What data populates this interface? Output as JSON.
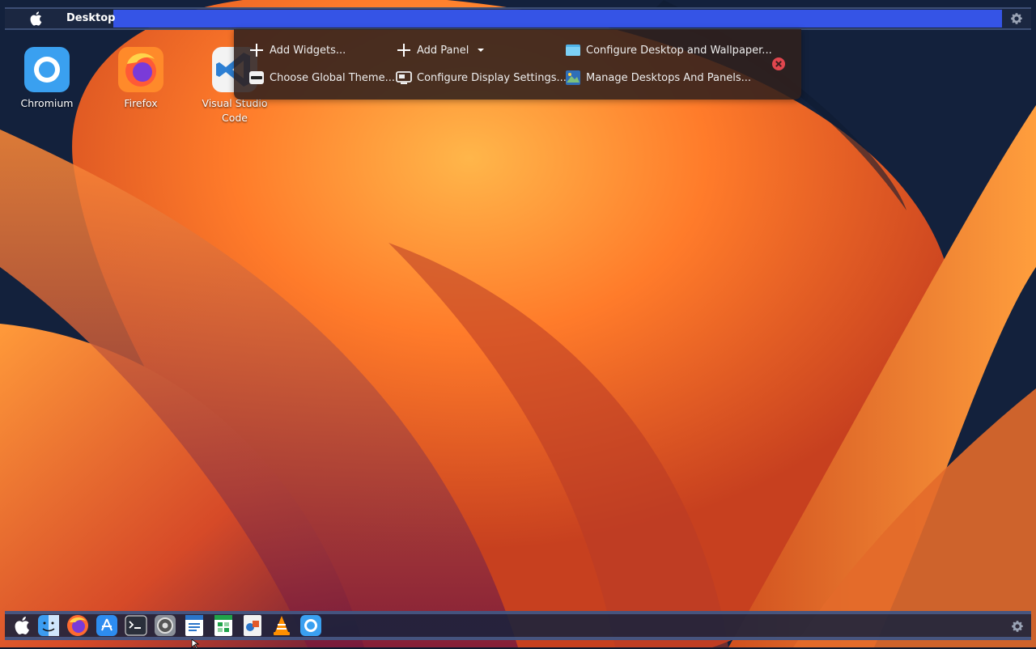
{
  "top_panel": {
    "title": "Desktop",
    "highlight_color": "#3554e6"
  },
  "toolbox": {
    "items": [
      {
        "label": "Add Widgets...",
        "icon": "plus-icon"
      },
      {
        "label": "Add Panel",
        "icon": "plus-icon",
        "has_dropdown": true
      },
      {
        "label": "Configure Desktop and Wallpaper...",
        "icon": "folder-icon"
      },
      {
        "label": "Choose Global Theme...",
        "icon": "theme-icon"
      },
      {
        "label": "Configure Display Settings...",
        "icon": "display-icon"
      },
      {
        "label": "Manage Desktops And Panels...",
        "icon": "desktops-icon"
      }
    ],
    "close_color": "#e0464e"
  },
  "desktop_icons": [
    {
      "label": "Chromium",
      "icon": "chromium-icon"
    },
    {
      "label": "Firefox",
      "icon": "firefox-icon"
    },
    {
      "label": "Visual Studio Code",
      "icon": "vscode-icon"
    }
  ],
  "dock": {
    "apps": [
      "apple-icon",
      "finder-icon",
      "firefox-icon",
      "app-store-icon",
      "terminal-icon",
      "system-settings-icon",
      "writer-icon",
      "calc-icon",
      "draw-icon",
      "vlc-icon",
      "chromium-icon"
    ]
  }
}
